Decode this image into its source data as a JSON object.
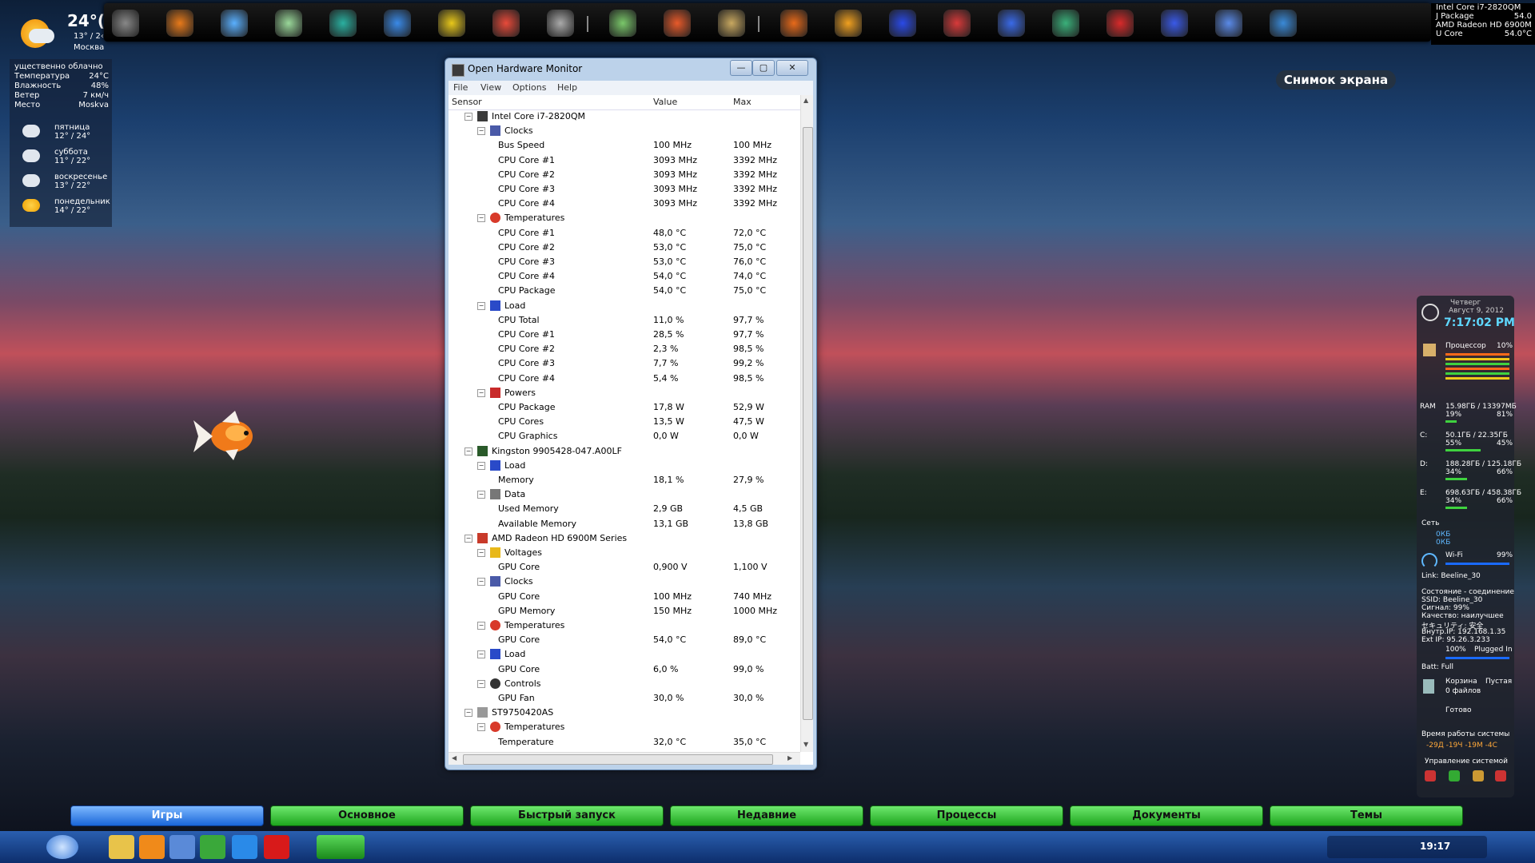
{
  "weather": {
    "temp": "24°(",
    "range": "13° / 2‹",
    "city": "Москва",
    "rows": [
      {
        "k": "ущественно облачно",
        "v": ""
      },
      {
        "k": "Температура",
        "v": "24°C"
      },
      {
        "k": "Влажность",
        "v": "48%"
      },
      {
        "k": "Ветер",
        "v": "7 км/ч"
      },
      {
        "k": "Место",
        "v": "Moskva"
      }
    ],
    "forecast": [
      {
        "name": "пятница",
        "temps": "12° / 24°",
        "icon": "cloud-icon"
      },
      {
        "name": "суббота",
        "temps": "11° / 22°",
        "icon": "cloud-icon"
      },
      {
        "name": "воскресенье",
        "temps": "13° / 22°",
        "icon": "cloud-sun-icon"
      },
      {
        "name": "понедельник",
        "temps": "14° / 22°",
        "icon": "sun-icon"
      }
    ]
  },
  "top_right": [
    {
      "label": "Intel Core i7-2820QM",
      "value": ""
    },
    {
      "label": "J Package",
      "value": "54.0"
    },
    {
      "label": "AMD Radeon HD 6900M",
      "value": ""
    },
    {
      "label": "U Core",
      "value": "54.0°C"
    }
  ],
  "snapshot_label": "Снимок экрана",
  "window": {
    "title": "Open Hardware Monitor",
    "menu": [
      "File",
      "View",
      "Options",
      "Help"
    ],
    "columns": [
      "Sensor",
      "Value",
      "Max"
    ]
  },
  "tree": [
    {
      "level": 0,
      "name": "Intel Core i7-2820QM",
      "value": "",
      "max": "",
      "icon": "cpu-icon",
      "toggle": "⊟"
    },
    {
      "level": 1,
      "name": "Clocks",
      "value": "",
      "max": "",
      "icon": "clock-icon",
      "toggle": "⊟"
    },
    {
      "level": 2,
      "name": "Bus Speed",
      "value": "100 MHz",
      "max": "100 MHz"
    },
    {
      "level": 2,
      "name": "CPU Core #1",
      "value": "3093 MHz",
      "max": "3392 MHz"
    },
    {
      "level": 2,
      "name": "CPU Core #2",
      "value": "3093 MHz",
      "max": "3392 MHz"
    },
    {
      "level": 2,
      "name": "CPU Core #3",
      "value": "3093 MHz",
      "max": "3392 MHz"
    },
    {
      "level": 2,
      "name": "CPU Core #4",
      "value": "3093 MHz",
      "max": "3392 MHz"
    },
    {
      "level": 1,
      "name": "Temperatures",
      "value": "",
      "max": "",
      "icon": "thermometer-icon",
      "toggle": "⊟"
    },
    {
      "level": 2,
      "name": "CPU Core #1",
      "value": "48,0 °C",
      "max": "72,0 °C"
    },
    {
      "level": 2,
      "name": "CPU Core #2",
      "value": "53,0 °C",
      "max": "75,0 °C"
    },
    {
      "level": 2,
      "name": "CPU Core #3",
      "value": "53,0 °C",
      "max": "76,0 °C"
    },
    {
      "level": 2,
      "name": "CPU Core #4",
      "value": "54,0 °C",
      "max": "74,0 °C"
    },
    {
      "level": 2,
      "name": "CPU Package",
      "value": "54,0 °C",
      "max": "75,0 °C"
    },
    {
      "level": 1,
      "name": "Load",
      "value": "",
      "max": "",
      "icon": "load-icon",
      "toggle": "⊟"
    },
    {
      "level": 2,
      "name": "CPU Total",
      "value": "11,0 %",
      "max": "97,7 %"
    },
    {
      "level": 2,
      "name": "CPU Core #1",
      "value": "28,5 %",
      "max": "97,7 %"
    },
    {
      "level": 2,
      "name": "CPU Core #2",
      "value": "2,3 %",
      "max": "98,5 %"
    },
    {
      "level": 2,
      "name": "CPU Core #3",
      "value": "7,7 %",
      "max": "99,2 %"
    },
    {
      "level": 2,
      "name": "CPU Core #4",
      "value": "5,4 %",
      "max": "98,5 %"
    },
    {
      "level": 1,
      "name": "Powers",
      "value": "",
      "max": "",
      "icon": "power-icon",
      "toggle": "⊟"
    },
    {
      "level": 2,
      "name": "CPU Package",
      "value": "17,8 W",
      "max": "52,9 W"
    },
    {
      "level": 2,
      "name": "CPU Cores",
      "value": "13,5 W",
      "max": "47,5 W"
    },
    {
      "level": 2,
      "name": "CPU Graphics",
      "value": "0,0 W",
      "max": "0,0 W"
    },
    {
      "level": 0,
      "name": "Kingston 9905428-047.A00LF",
      "value": "",
      "max": "",
      "icon": "ram-icon",
      "toggle": "⊟"
    },
    {
      "level": 1,
      "name": "Load",
      "value": "",
      "max": "",
      "icon": "load-icon",
      "toggle": "⊟"
    },
    {
      "level": 2,
      "name": "Memory",
      "value": "18,1 %",
      "max": "27,9 %"
    },
    {
      "level": 1,
      "name": "Data",
      "value": "",
      "max": "",
      "icon": "data-icon",
      "toggle": "⊟"
    },
    {
      "level": 2,
      "name": "Used Memory",
      "value": "2,9 GB",
      "max": "4,5 GB"
    },
    {
      "level": 2,
      "name": "Available Memory",
      "value": "13,1 GB",
      "max": "13,8 GB"
    },
    {
      "level": 0,
      "name": "AMD Radeon HD 6900M Series",
      "value": "",
      "max": "",
      "icon": "gpu-icon",
      "toggle": "⊟"
    },
    {
      "level": 1,
      "name": "Voltages",
      "value": "",
      "max": "",
      "icon": "voltage-icon",
      "toggle": "⊟"
    },
    {
      "level": 2,
      "name": "GPU Core",
      "value": "0,900 V",
      "max": "1,100 V"
    },
    {
      "level": 1,
      "name": "Clocks",
      "value": "",
      "max": "",
      "icon": "clock-icon",
      "toggle": "⊟"
    },
    {
      "level": 2,
      "name": "GPU Core",
      "value": "100 MHz",
      "max": "740 MHz"
    },
    {
      "level": 2,
      "name": "GPU Memory",
      "value": "150 MHz",
      "max": "1000 MHz"
    },
    {
      "level": 1,
      "name": "Temperatures",
      "value": "",
      "max": "",
      "icon": "thermometer-icon",
      "toggle": "⊟"
    },
    {
      "level": 2,
      "name": "GPU Core",
      "value": "54,0 °C",
      "max": "89,0 °C"
    },
    {
      "level": 1,
      "name": "Load",
      "value": "",
      "max": "",
      "icon": "load-icon",
      "toggle": "⊟"
    },
    {
      "level": 2,
      "name": "GPU Core",
      "value": "6,0 %",
      "max": "99,0 %"
    },
    {
      "level": 1,
      "name": "Controls",
      "value": "",
      "max": "",
      "icon": "fan-icon",
      "toggle": "⊟"
    },
    {
      "level": 2,
      "name": "GPU Fan",
      "value": "30,0 %",
      "max": "30,0 %"
    },
    {
      "level": 0,
      "name": "ST9750420AS",
      "value": "",
      "max": "",
      "icon": "hdd-icon",
      "toggle": "⊟"
    },
    {
      "level": 1,
      "name": "Temperatures",
      "value": "",
      "max": "",
      "icon": "thermometer-icon",
      "toggle": "⊟"
    },
    {
      "level": 2,
      "name": "Temperature",
      "value": "32,0 °C",
      "max": "35,0 °C"
    }
  ],
  "sidebar": {
    "day": "Четверг",
    "date": "Август 9, 2012",
    "time": "7:17:02 PM",
    "cpu_label": "Процессор",
    "cpu_pct": "10%",
    "ram_label": "RAM",
    "ram_text": "15.98ГБ / 13397МБ",
    "ram_left": "19%",
    "ram_right": "81%",
    "c_label": "C:",
    "c_text": "50.1ГБ / 22.35ГБ",
    "c_left": "55%",
    "c_right": "45%",
    "d_label": "D:",
    "d_text": "188.28ГБ / 125.18ГБ",
    "d_left": "34%",
    "d_right": "66%",
    "e_label": "E:",
    "e_text": "698.63ГБ / 458.38ГБ",
    "e_left": "34%",
    "e_right": "66%",
    "net_label": "Сеть",
    "net_up": "0КБ",
    "net_down": "0КБ",
    "wifi_label": "Wi-Fi",
    "wifi_pct": "99%",
    "link": "Link: Beeline_30",
    "status_lines": [
      "Состояние - соединение",
      "SSID: Beeline_30",
      "Сигнал: 99%",
      "Качество: наилучшее",
      "セキュリティ: 安全",
      "Внутр.IP: 192.168.1.35",
      "Ext IP: 95.26.3.233"
    ],
    "batt_pct": "100%",
    "batt_status": "Plugged In",
    "batt_full": "Batt: Full",
    "bin_label": "Корзина",
    "bin_state": "Пустая",
    "bin_files": "0 файлов",
    "ready": "Готово",
    "uptime_label": "Время работы системы",
    "uptime": "-29Д -19Ч -19М -4С",
    "manage_label": "Управление системой"
  },
  "tabs": [
    "Игры",
    "Основное",
    "Быстрый запуск",
    "Недавние",
    "Процессы",
    "Документы",
    "Темы"
  ],
  "clock": "19:17"
}
